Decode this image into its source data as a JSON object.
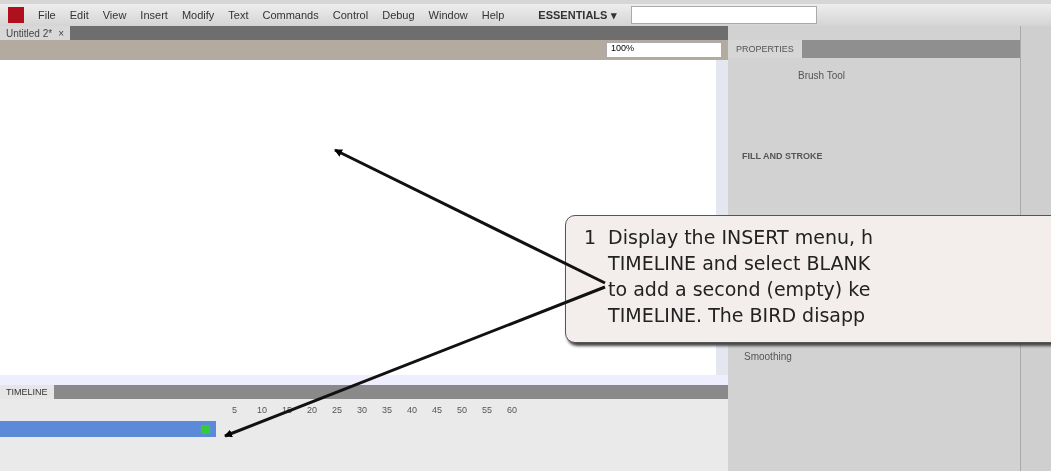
{
  "menu_bar": {
    "items": [
      "File",
      "Edit",
      "View",
      "Insert",
      "Modify",
      "Text",
      "Commands",
      "Control",
      "Debug",
      "Window",
      "Help"
    ],
    "workspace": "ESSENTIALS",
    "workspace_caret": "▾"
  },
  "document_tab": {
    "title": "Untitled 2*",
    "close": "×"
  },
  "edit_bar": {
    "zoom": "100%"
  },
  "properties_panel": {
    "tabs": [
      {
        "label": "PROPERTIES",
        "selected": true
      }
    ],
    "tool_name": "Brush Tool",
    "section": "FILL AND STROKE",
    "smoothing_label": "Smoothing"
  },
  "timeline": {
    "tabs": [
      {
        "label": "TIMELINE",
        "selected": true
      }
    ],
    "frame_numbers": [
      "5",
      "10",
      "15",
      "20",
      "25",
      "30",
      "35",
      "40",
      "45",
      "50",
      "55",
      "60"
    ],
    "layers": [
      {
        "selected": true
      }
    ]
  },
  "callout": {
    "step": "1",
    "lines": [
      "Display the INSERT menu, h",
      "TIMELINE and select BLANK",
      "to add a second (empty) ke",
      "TIMELINE.  The BIRD disapp"
    ]
  }
}
